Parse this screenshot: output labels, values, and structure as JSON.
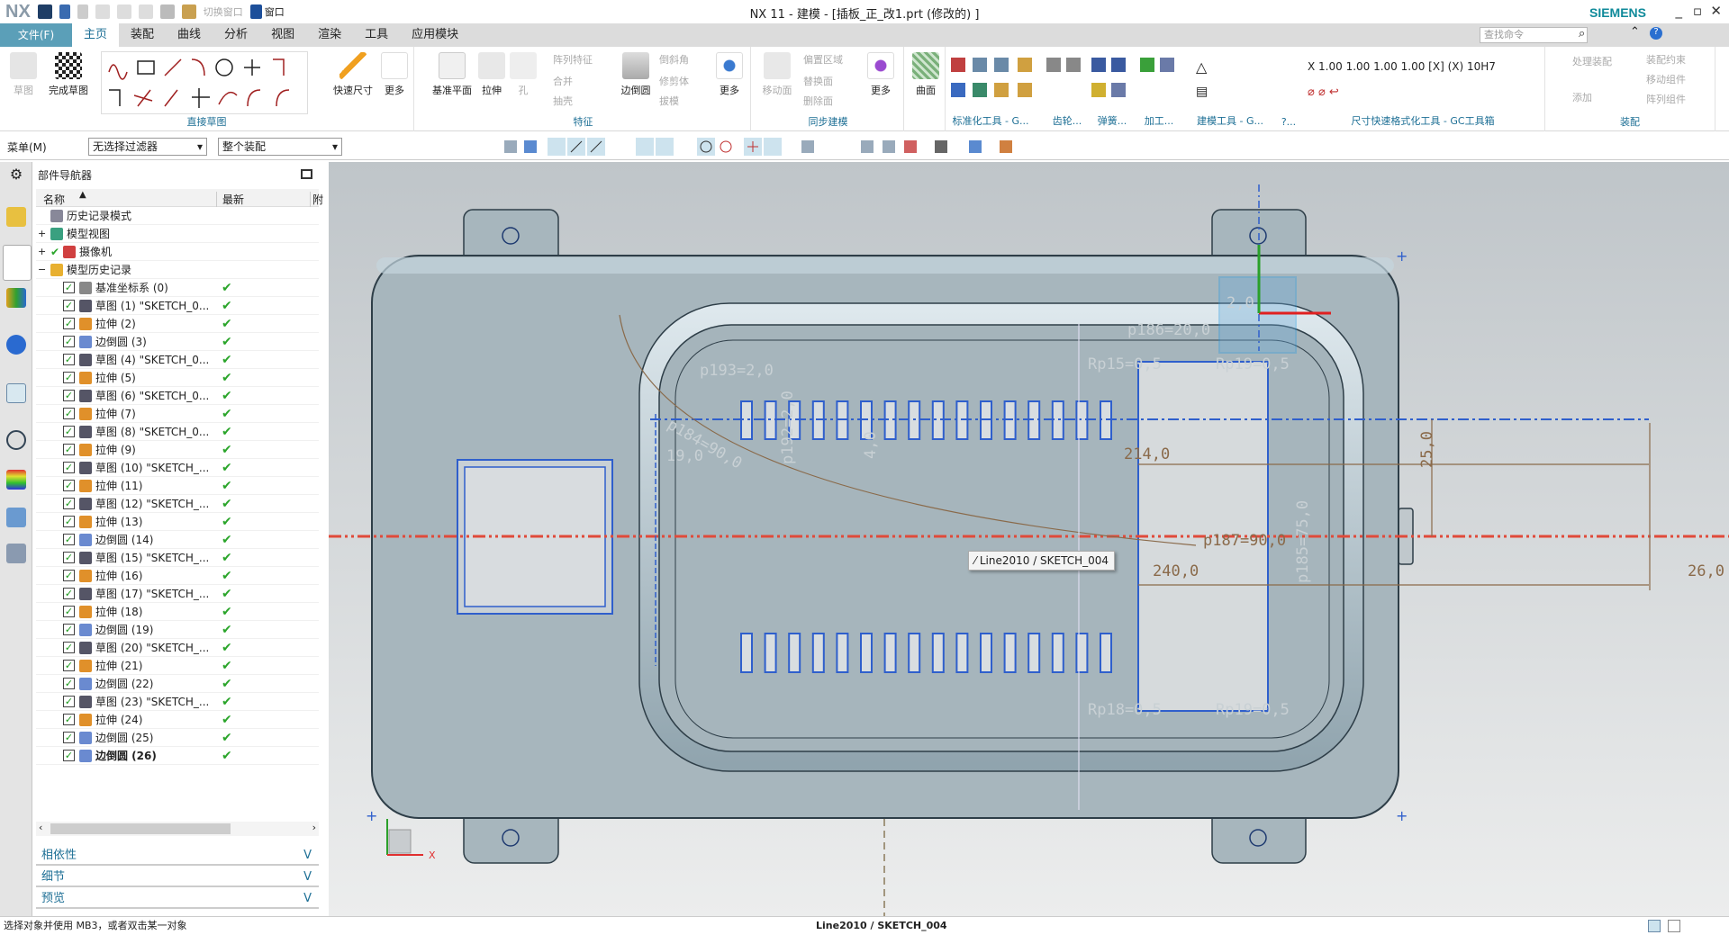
{
  "titlebar": {
    "logo": "NX",
    "title": "NX 11 - 建模 - [插板_正_改1.prt  (修改的) ]",
    "brand": "SIEMENS",
    "switch_window": "切换窗口",
    "window_menu": "窗口"
  },
  "tabs": {
    "file": "文件(F)",
    "items": [
      "主页",
      "装配",
      "曲线",
      "分析",
      "视图",
      "渲染",
      "工具",
      "应用模块"
    ],
    "active": "主页"
  },
  "search": {
    "placeholder": "查找命令"
  },
  "ribbon": {
    "sketch": "草图",
    "finish_sketch": "完成草图",
    "direct_sketch_group": "直接草图",
    "quick_dim": "快速尺寸",
    "more": "更多",
    "datum_plane": "基准平面",
    "extrude": "拉伸",
    "hole": "孔",
    "pattern_feature": "阵列特征",
    "unite": "合并",
    "shell": "抽壳",
    "edge_blend": "边倒圆",
    "chamfer": "倒斜角",
    "trim_body": "修剪体",
    "draft": "拔模",
    "feature_group": "特征",
    "move_face": "移动面",
    "offset_region": "偏置区域",
    "replace_face": "替换面",
    "delete_face": "删除面",
    "sync_group": "同步建模",
    "surface": "曲面",
    "std_tools": "标准化工具 - G...",
    "gear": "齿轮...",
    "spring": "弹簧...",
    "machining": "加工...",
    "modeling_tools": "建模工具 - G...",
    "misc": "?...",
    "dim_format": "尺寸快速格式化工具 - GC工具箱",
    "assembly_group": "装配",
    "process_assembly": "处理装配",
    "add": "添加",
    "assembly_constraint": "装配约束",
    "move_component": "移动组件",
    "pattern_component": "阵列组件"
  },
  "toolbar2": {
    "menu": "菜单(M)",
    "filter": "无选择过滤器",
    "scope": "整个装配"
  },
  "navigator": {
    "title": "部件导航器",
    "columns": [
      "名称",
      "最新",
      "附"
    ],
    "top_nodes": [
      "历史记录模式",
      "模型视图",
      "摄像机",
      "模型历史记录"
    ],
    "features": [
      "基准坐标系 (0)",
      "草图 (1) \"SKETCH_0...",
      "拉伸 (2)",
      "边倒圆 (3)",
      "草图 (4) \"SKETCH_0...",
      "拉伸 (5)",
      "草图 (6) \"SKETCH_0...",
      "拉伸 (7)",
      "草图 (8) \"SKETCH_0...",
      "拉伸 (9)",
      "草图 (10) \"SKETCH_...",
      "拉伸 (11)",
      "草图 (12) \"SKETCH_...",
      "拉伸 (13)",
      "边倒圆 (14)",
      "草图 (15) \"SKETCH_...",
      "拉伸 (16)",
      "草图 (17) \"SKETCH_...",
      "拉伸 (18)",
      "边倒圆 (19)",
      "草图 (20) \"SKETCH_...",
      "拉伸 (21)",
      "边倒圆 (22)",
      "草图 (23) \"SKETCH_...",
      "拉伸 (24)",
      "边倒圆 (25)",
      "边倒圆 (26)"
    ],
    "panels": [
      "相依性",
      "细节",
      "预览"
    ]
  },
  "viewport": {
    "tooltip": "Line2010 / SKETCH_004",
    "dims": [
      "p193=2,0",
      "19,0",
      "p184=90,0",
      "214,0",
      "240,0",
      "25,0",
      "26,0",
      "2,0",
      "p186=20,0",
      "Rp15=0,5",
      "Rp19=0,5",
      "Rp18=0,5",
      "Rp19=0,5",
      "p187=90,0",
      "p185=75,0",
      "4,0",
      "p192=2,0"
    ],
    "axis_x": "X",
    "colors": {
      "body": "#a7b6bd",
      "sketch": "#2f5fcc",
      "dim": "#8a6a4a",
      "centerline": "#e04a3a"
    }
  },
  "status": {
    "left": "选择对象并使用 MB3，或者双击某一对象",
    "center": "Line2010 / SKETCH_004"
  }
}
